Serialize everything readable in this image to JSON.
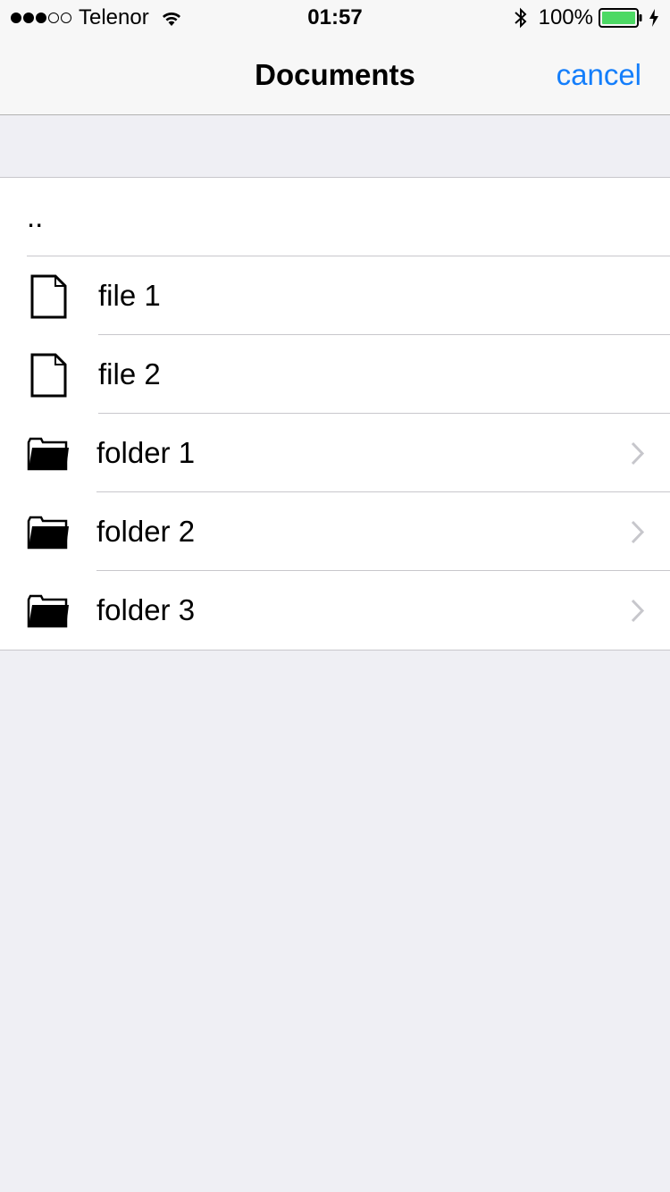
{
  "status_bar": {
    "signal_dots_filled": 3,
    "signal_dots_total": 5,
    "carrier": "Telenor",
    "time": "01:57",
    "battery_percent": "100%",
    "battery_color": "#4cd964"
  },
  "nav": {
    "title": "Documents",
    "cancel_label": "cancel",
    "accent_color": "#147efb"
  },
  "list": {
    "parent_label": "..",
    "items": [
      {
        "type": "file",
        "icon": "file-icon",
        "label": "file 1"
      },
      {
        "type": "file",
        "icon": "file-icon",
        "label": "file 2"
      },
      {
        "type": "folder",
        "icon": "folder-icon",
        "label": "folder 1"
      },
      {
        "type": "folder",
        "icon": "folder-icon",
        "label": "folder 2"
      },
      {
        "type": "folder",
        "icon": "folder-icon",
        "label": "folder 3"
      }
    ]
  }
}
